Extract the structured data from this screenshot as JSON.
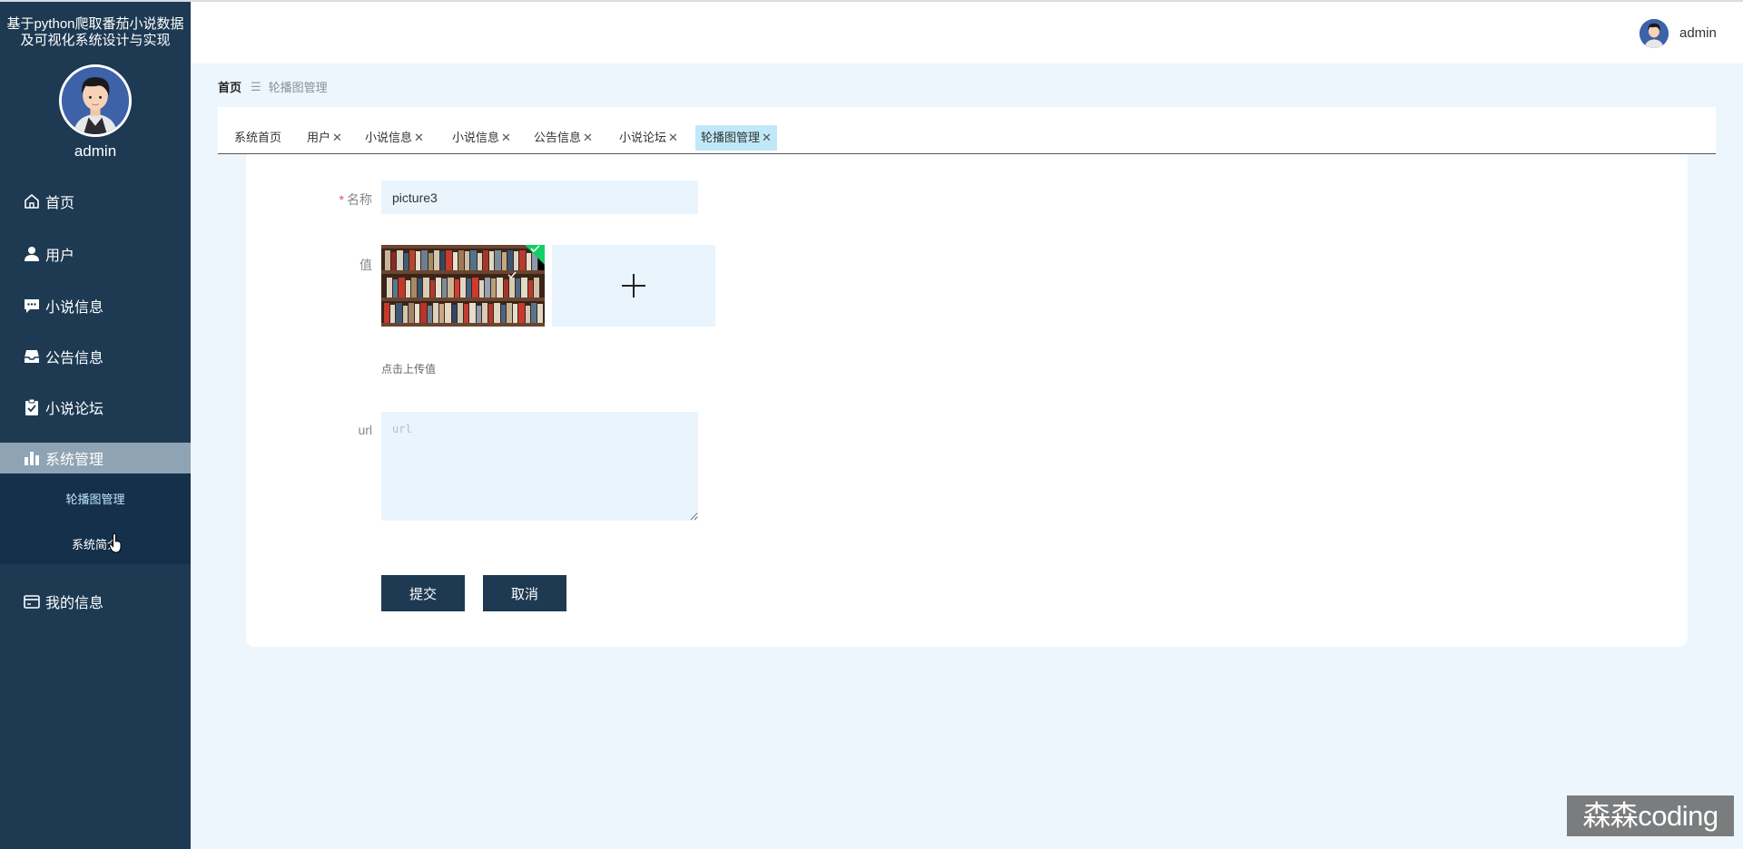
{
  "sidebar": {
    "title": "基于python爬取番茄小说数据及可视化系统设计与实现",
    "username": "admin",
    "items": [
      {
        "label": "首页",
        "icon": "home-icon"
      },
      {
        "label": "用户",
        "icon": "user-icon"
      },
      {
        "label": "小说信息",
        "icon": "chat-icon"
      },
      {
        "label": "公告信息",
        "icon": "inbox-icon"
      },
      {
        "label": "小说论坛",
        "icon": "clipboard-check-icon"
      },
      {
        "label": "系统管理",
        "icon": "bar-chart-icon"
      },
      {
        "label": "我的信息",
        "icon": "card-icon"
      }
    ],
    "submenu": [
      {
        "label": "轮播图管理"
      },
      {
        "label": "系统简介"
      }
    ]
  },
  "header": {
    "username": "admin"
  },
  "breadcrumb": {
    "home": "首页",
    "separator": "☰",
    "current": "轮播图管理"
  },
  "tabs": [
    {
      "label": "系统首页",
      "closable": false
    },
    {
      "label": "用户",
      "closable": true
    },
    {
      "label": "小说信息",
      "closable": true
    },
    {
      "label": "小说信息",
      "closable": true
    },
    {
      "label": "公告信息",
      "closable": true
    },
    {
      "label": "小说论坛",
      "closable": true
    },
    {
      "label": "轮播图管理",
      "closable": true,
      "active": true
    }
  ],
  "form": {
    "name_label": "名称",
    "required_mark": "*",
    "name_value": "picture3",
    "value_label": "值",
    "upload_hint": "点击上传值",
    "url_label": "url",
    "url_placeholder": "url",
    "submit": "提交",
    "cancel": "取消"
  },
  "watermark": "森森coding",
  "colors": {
    "sidebar_bg": "#1d3a52",
    "active_menu": "#8ea3b3",
    "active_tab": "#bfe8f8",
    "button": "#1e3a52",
    "input_bg": "#eaf4fd",
    "upload_success": "#13ce66"
  }
}
